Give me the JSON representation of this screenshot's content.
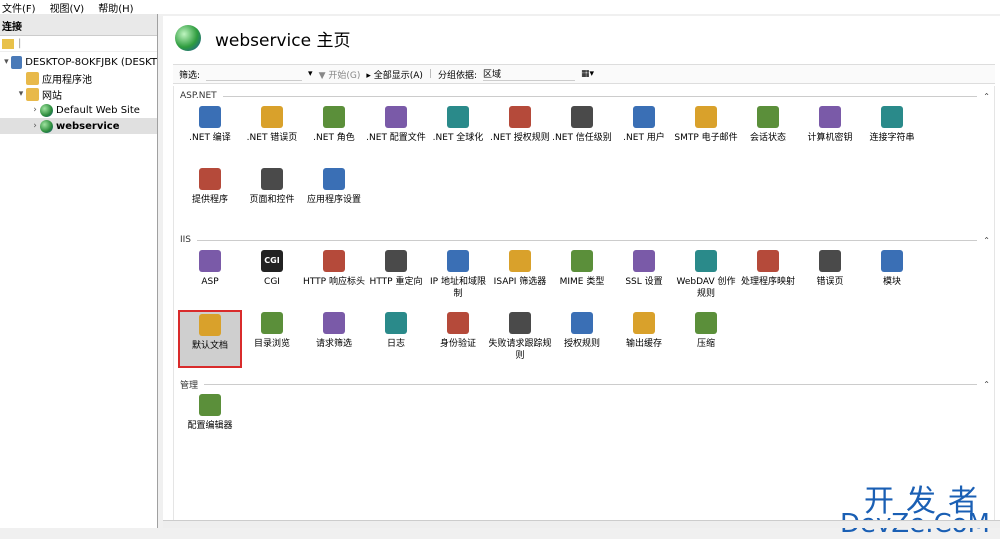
{
  "menu": [
    "文件(F)",
    "视图(V)",
    "帮助(H)"
  ],
  "left": {
    "header": "连接",
    "tree": [
      {
        "label": "DESKTOP-8OKFJBK (DESKT",
        "level": 0,
        "expander": "▾"
      },
      {
        "label": "应用程序池",
        "level": 1,
        "expander": ""
      },
      {
        "label": "网站",
        "level": 1,
        "expander": "▾"
      },
      {
        "label": "Default Web Site",
        "level": 2,
        "expander": "›"
      },
      {
        "label": "webservice",
        "level": 2,
        "expander": "›"
      }
    ]
  },
  "main": {
    "title": "webservice 主页",
    "filter": {
      "label": "筛选:",
      "start": "开始(G)",
      "showall": "全部显示(A)",
      "group_label": "分组依据:",
      "group_value": "区域"
    },
    "sections": [
      {
        "name": "ASP.NET",
        "items": [
          ".NET 编译",
          ".NET 错误页",
          ".NET 角色",
          ".NET 配置文件",
          ".NET 全球化",
          ".NET 授权规则",
          ".NET 信任级别",
          ".NET 用户",
          "SMTP 电子邮件",
          "会话状态",
          "计算机密钥",
          "连接字符串",
          "提供程序",
          "页面和控件",
          "应用程序设置"
        ]
      },
      {
        "name": "IIS",
        "items": [
          "ASP",
          "CGI",
          "HTTP 响应标头",
          "HTTP 重定向",
          "IP 地址和域限制",
          "ISAPI 筛选器",
          "MIME 类型",
          "SSL 设置",
          "WebDAV 创作规则",
          "处理程序映射",
          "错误页",
          "模块",
          "默认文档",
          "目录浏览",
          "请求筛选",
          "日志",
          "身份验证",
          "失败请求跟踪规则",
          "授权规则",
          "输出缓存",
          "压缩"
        ]
      },
      {
        "name": "管理",
        "items": [
          "配置编辑器"
        ]
      }
    ],
    "selected": "默认文档"
  },
  "watermark": {
    "line1": "开发者",
    "line2": "DevZe.CoM"
  },
  "colors": {
    "accent": "#1a5fb4",
    "selected_border": "#d92b2b"
  }
}
